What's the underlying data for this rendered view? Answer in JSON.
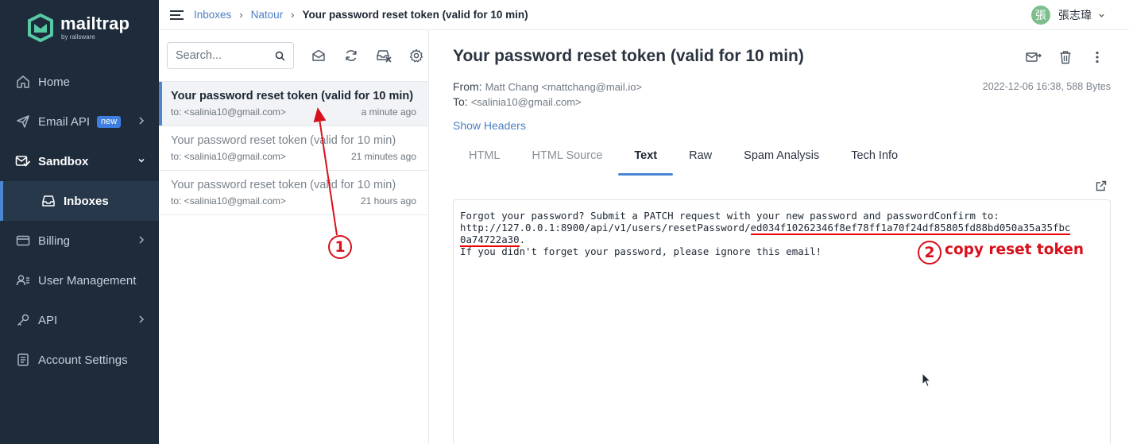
{
  "brand": {
    "name": "mailtrap",
    "tagline": "by railsware",
    "colors": {
      "accent": "#4b86d1",
      "sidebar": "#1d2b3b",
      "annotation": "#d8101b",
      "logo": "#59c9a5"
    }
  },
  "sidebar": {
    "items": [
      {
        "label": "Home",
        "icon": "home-icon"
      },
      {
        "label": "Email API",
        "icon": "send-icon",
        "badge": "new"
      },
      {
        "label": "Sandbox",
        "icon": "sandbox-icon"
      },
      {
        "label": "Inboxes",
        "icon": "inbox-icon"
      },
      {
        "label": "Billing",
        "icon": "card-icon"
      },
      {
        "label": "User Management",
        "icon": "users-icon"
      },
      {
        "label": "API",
        "icon": "key-icon"
      },
      {
        "label": "Account Settings",
        "icon": "settings-doc-icon"
      }
    ]
  },
  "topbar": {
    "breadcrumb": [
      "Inboxes",
      "Natour",
      "Your password reset token (valid for 10 min)"
    ],
    "separator": "›",
    "user": {
      "avatar_char": "張",
      "name": "張志瑋"
    }
  },
  "list": {
    "search_placeholder": "Search...",
    "messages": [
      {
        "subject": "Your password reset token (valid for 10 min)",
        "to": "to: <salinia10@gmail.com>",
        "time": "a minute ago"
      },
      {
        "subject": "Your password reset token (valid for 10 min)",
        "to": "to: <salinia10@gmail.com>",
        "time": "21 minutes ago"
      },
      {
        "subject": "Your password reset token (valid for 10 min)",
        "to": "to: <salinia10@gmail.com>",
        "time": "21 hours ago"
      }
    ]
  },
  "detail": {
    "title": "Your password reset token (valid for 10 min)",
    "from_label": "From:",
    "from_value": "Matt Chang <mattchang@mail.io>",
    "to_label": "To:",
    "to_value": "<salinia10@gmail.com>",
    "date_size": "2022-12-06 16:38, 588 Bytes",
    "show_headers": "Show Headers",
    "tabs": [
      "HTML",
      "HTML Source",
      "Text",
      "Raw",
      "Spam Analysis",
      "Tech Info"
    ],
    "active_tab": "Text",
    "body": {
      "line1": "Forgot your password? Submit a PATCH request with your new password and passwordConfirm to:",
      "line2_prefix": "http://127.0.0.1:8900/api/v1/users/resetPassword/",
      "token_part1": "ed034f10262346f8ef78ff1a70f24df85805fd88bd050a35a35fbc",
      "token_part2": "0a74722a30",
      "line3_suffix": ".",
      "line4": "If you didn't forget your password, please ignore this email!"
    }
  },
  "annotations": {
    "step1": "1",
    "step2": "2",
    "step2_label": "copy reset token"
  }
}
